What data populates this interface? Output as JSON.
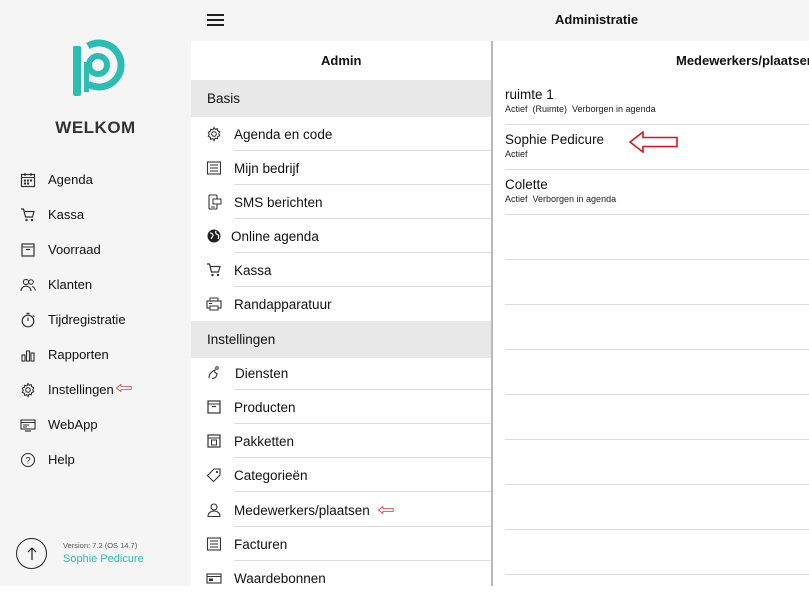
{
  "header": {
    "title": "Administratie"
  },
  "sidebar": {
    "welcome": "WELKOM",
    "items": [
      {
        "label": "Agenda",
        "icon": "calendar-icon"
      },
      {
        "label": "Kassa",
        "icon": "cart-icon"
      },
      {
        "label": "Voorraad",
        "icon": "box-icon"
      },
      {
        "label": "Klanten",
        "icon": "users-icon"
      },
      {
        "label": "Tijdregistratie",
        "icon": "stopwatch-icon"
      },
      {
        "label": "Rapporten",
        "icon": "bar-chart-icon"
      },
      {
        "label": "Instellingen",
        "icon": "gear-icon"
      },
      {
        "label": "WebApp",
        "icon": "webapp-icon"
      },
      {
        "label": "Help",
        "icon": "help-icon"
      }
    ],
    "version": "Version: 7.2 (OS 14.7)",
    "user": "Sophie Pedicure"
  },
  "admin": {
    "title": "Admin",
    "sections": [
      {
        "title": "Basis",
        "items": [
          {
            "label": "Agenda en code",
            "icon": "gear-icon"
          },
          {
            "label": "Mijn bedrijf",
            "icon": "list-icon"
          },
          {
            "label": "SMS berichten",
            "icon": "sms-icon"
          },
          {
            "label": "Online agenda",
            "icon": "globe-icon"
          },
          {
            "label": "Kassa",
            "icon": "cart-icon"
          },
          {
            "label": "Randapparatuur",
            "icon": "printer-icon"
          }
        ]
      },
      {
        "title": "Instellingen",
        "items": [
          {
            "label": "Diensten",
            "icon": "spa-icon"
          },
          {
            "label": "Producten",
            "icon": "box-icon"
          },
          {
            "label": "Pakketten",
            "icon": "package-icon"
          },
          {
            "label": "Categorieën",
            "icon": "tags-icon"
          },
          {
            "label": "Medewerkers/plaatsen",
            "icon": "person-icon"
          },
          {
            "label": "Facturen",
            "icon": "list-icon"
          },
          {
            "label": "Waardebonnen",
            "icon": "voucher-icon"
          }
        ]
      }
    ]
  },
  "employees": {
    "title": "Medewerkers/plaatsen",
    "rows": [
      {
        "name": "ruimte 1",
        "subtitle": "Actief  (Ruimte)  Verborgen in agenda"
      },
      {
        "name": "Sophie Pedicure",
        "subtitle": "Actief"
      },
      {
        "name": "Colette",
        "subtitle": "Actief  Verborgen in agenda"
      }
    ]
  },
  "colors": {
    "accent": "#2bbdb3",
    "annotation_arrow": "#d9141c",
    "section_bg": "#e8e8e8",
    "sidebar_bg": "#f5f5f5"
  }
}
